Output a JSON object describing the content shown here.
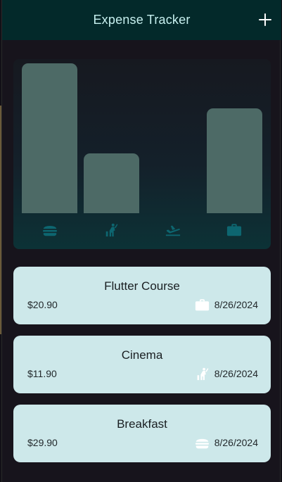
{
  "appbar": {
    "title": "Expense Tracker"
  },
  "colors": {
    "appbar_bg": "#03292a",
    "bar": "#4d6a66",
    "category_icon": "#0d6670",
    "card_bg": "#cde8ea",
    "card_icon": "#ffffff"
  },
  "chart_data": {
    "type": "bar",
    "categories": [
      "food",
      "leisure",
      "travel",
      "work"
    ],
    "values": [
      29.9,
      11.9,
      0,
      20.9
    ],
    "title": "",
    "xlabel": "",
    "ylabel": "",
    "grid": false
  },
  "category_icons": [
    "burger-icon",
    "leisure-icon",
    "flight-icon",
    "work-icon"
  ],
  "expenses": [
    {
      "title": "Flutter Course",
      "amount": "$20.90",
      "date": "8/26/2024",
      "icon": "work-icon"
    },
    {
      "title": "Cinema",
      "amount": "$11.90",
      "date": "8/26/2024",
      "icon": "leisure-icon"
    },
    {
      "title": "Breakfast",
      "amount": "$29.90",
      "date": "8/26/2024",
      "icon": "burger-icon"
    }
  ]
}
